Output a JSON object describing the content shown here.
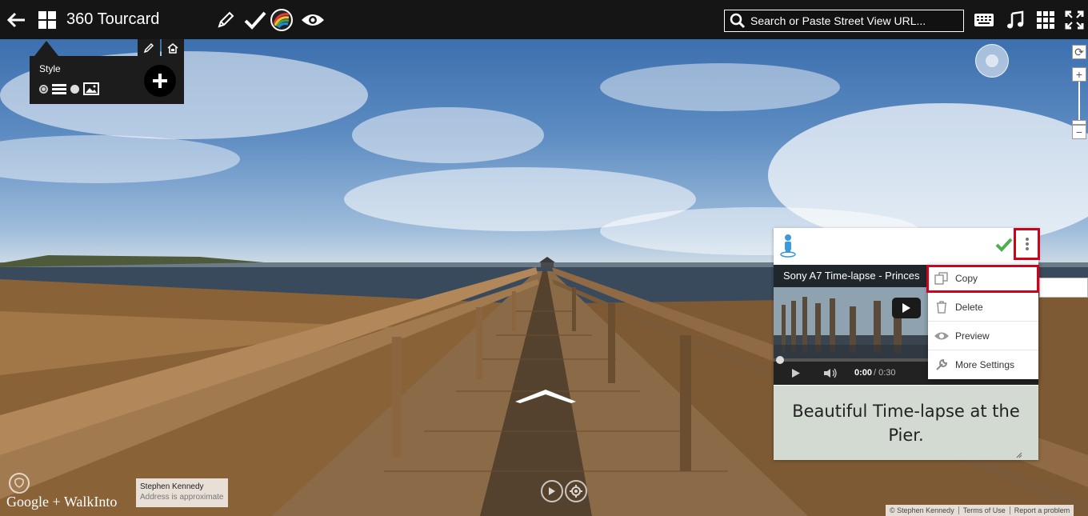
{
  "app": {
    "title": "360 Tourcard"
  },
  "search": {
    "placeholder": "Search or Paste Street View URL..."
  },
  "style_panel": {
    "label": "Style"
  },
  "card": {
    "video_title": "Sony A7 Time-lapse - Princes",
    "time_current": "0:00",
    "time_total": "/ 0:30",
    "caption": "Beautiful Time-lapse at the Pier."
  },
  "menu": {
    "items": [
      {
        "label": "Copy",
        "icon": "copy-icon"
      },
      {
        "label": "Delete",
        "icon": "trash-icon"
      },
      {
        "label": "Preview",
        "icon": "eye-icon"
      },
      {
        "label": "More Settings",
        "icon": "wrench-icon"
      }
    ]
  },
  "footer": {
    "logo": "Google + WalkInto",
    "address_name": "Stephen Kennedy",
    "address_note": "Address is approximate",
    "copyright": "© Stephen Kennedy",
    "terms": "Terms of Use",
    "report": "Report a problem"
  },
  "colors": {
    "highlight": "#d0021b",
    "topbar": "#151515",
    "check": "#4caf50",
    "caption_bg": "#d2dad2"
  }
}
